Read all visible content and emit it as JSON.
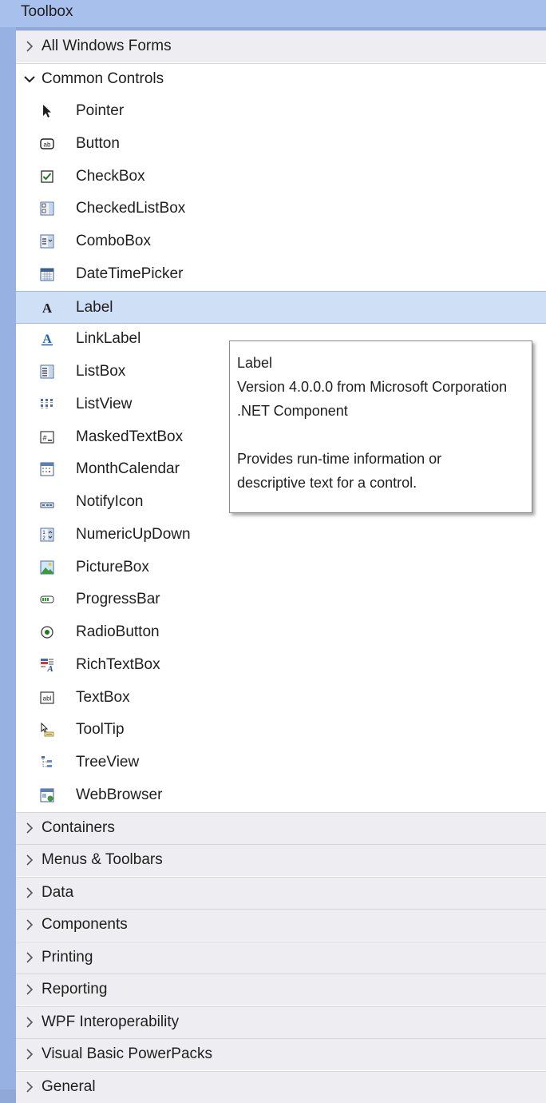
{
  "window": {
    "title": "Toolbox"
  },
  "tabs_before": [
    {
      "label": "All Windows Forms",
      "expanded": false
    }
  ],
  "expanded_tab": {
    "label": "Common Controls",
    "expanded": true
  },
  "items": [
    {
      "label": "Pointer",
      "icon": "pointer-icon"
    },
    {
      "label": "Button",
      "icon": "button-icon"
    },
    {
      "label": "CheckBox",
      "icon": "checkbox-icon"
    },
    {
      "label": "CheckedListBox",
      "icon": "checkedlistbox-icon"
    },
    {
      "label": "ComboBox",
      "icon": "combobox-icon"
    },
    {
      "label": "DateTimePicker",
      "icon": "datetimepicker-icon"
    },
    {
      "label": "Label",
      "icon": "label-icon",
      "selected": true
    },
    {
      "label": "LinkLabel",
      "icon": "linklabel-icon"
    },
    {
      "label": "ListBox",
      "icon": "listbox-icon"
    },
    {
      "label": "ListView",
      "icon": "listview-icon"
    },
    {
      "label": "MaskedTextBox",
      "icon": "maskedtextbox-icon"
    },
    {
      "label": "MonthCalendar",
      "icon": "monthcalendar-icon"
    },
    {
      "label": "NotifyIcon",
      "icon": "notifyicon-icon"
    },
    {
      "label": "NumericUpDown",
      "icon": "numericupdown-icon"
    },
    {
      "label": "PictureBox",
      "icon": "picturebox-icon"
    },
    {
      "label": "ProgressBar",
      "icon": "progressbar-icon"
    },
    {
      "label": "RadioButton",
      "icon": "radiobutton-icon"
    },
    {
      "label": "RichTextBox",
      "icon": "richtextbox-icon"
    },
    {
      "label": "TextBox",
      "icon": "textbox-icon"
    },
    {
      "label": "ToolTip",
      "icon": "tooltip-icon"
    },
    {
      "label": "TreeView",
      "icon": "treeview-icon"
    },
    {
      "label": "WebBrowser",
      "icon": "webbrowser-icon"
    }
  ],
  "tabs_after": [
    {
      "label": "Containers",
      "expanded": false
    },
    {
      "label": "Menus & Toolbars",
      "expanded": false
    },
    {
      "label": "Data",
      "expanded": false
    },
    {
      "label": "Components",
      "expanded": false
    },
    {
      "label": "Printing",
      "expanded": false
    },
    {
      "label": "Reporting",
      "expanded": false
    },
    {
      "label": "WPF Interoperability",
      "expanded": false
    },
    {
      "label": "Visual Basic PowerPacks",
      "expanded": false
    },
    {
      "label": "General",
      "expanded": false
    }
  ],
  "tooltip": {
    "name": "Label",
    "version": "Version 4.0.0.0 from Microsoft Corporation",
    "kind": ".NET Component",
    "description_line1": "Provides run-time information or",
    "description_line2": "descriptive text for a control."
  },
  "colors": {
    "selection": "#cfe0f6",
    "tab_background": "#eeeef2",
    "title_bar": "#a8c0ec"
  }
}
